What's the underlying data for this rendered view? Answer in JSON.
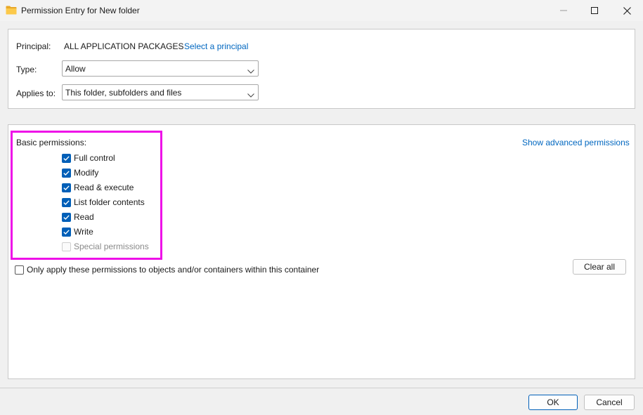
{
  "window": {
    "title": "Permission Entry for New folder",
    "icon": "folder-icon",
    "controls": [
      "minimize-icon",
      "maximize-icon",
      "close-icon"
    ]
  },
  "principal": {
    "label": "Principal:",
    "value": "ALL APPLICATION PACKAGES",
    "link": "Select a principal"
  },
  "type": {
    "label": "Type:",
    "value": "Allow"
  },
  "applies_to": {
    "label": "Applies to:",
    "value": "This folder, subfolders and files"
  },
  "permissions": {
    "heading": "Basic permissions:",
    "advanced_link": "Show advanced permissions",
    "items": [
      {
        "label": "Full control",
        "state": "checked"
      },
      {
        "label": "Modify",
        "state": "checked"
      },
      {
        "label": "Read & execute",
        "state": "checked"
      },
      {
        "label": "List folder contents",
        "state": "checked"
      },
      {
        "label": "Read",
        "state": "checked"
      },
      {
        "label": "Write",
        "state": "checked"
      },
      {
        "label": "Special permissions",
        "state": "disabled"
      }
    ],
    "only_apply_label": "Only apply these permissions to objects and/or containers within this container",
    "clear_all": "Clear all"
  },
  "footer": {
    "ok": "OK",
    "cancel": "Cancel"
  },
  "colors": {
    "accent": "#005fb8",
    "link": "#0067c0",
    "highlight": "#ee11e8"
  }
}
